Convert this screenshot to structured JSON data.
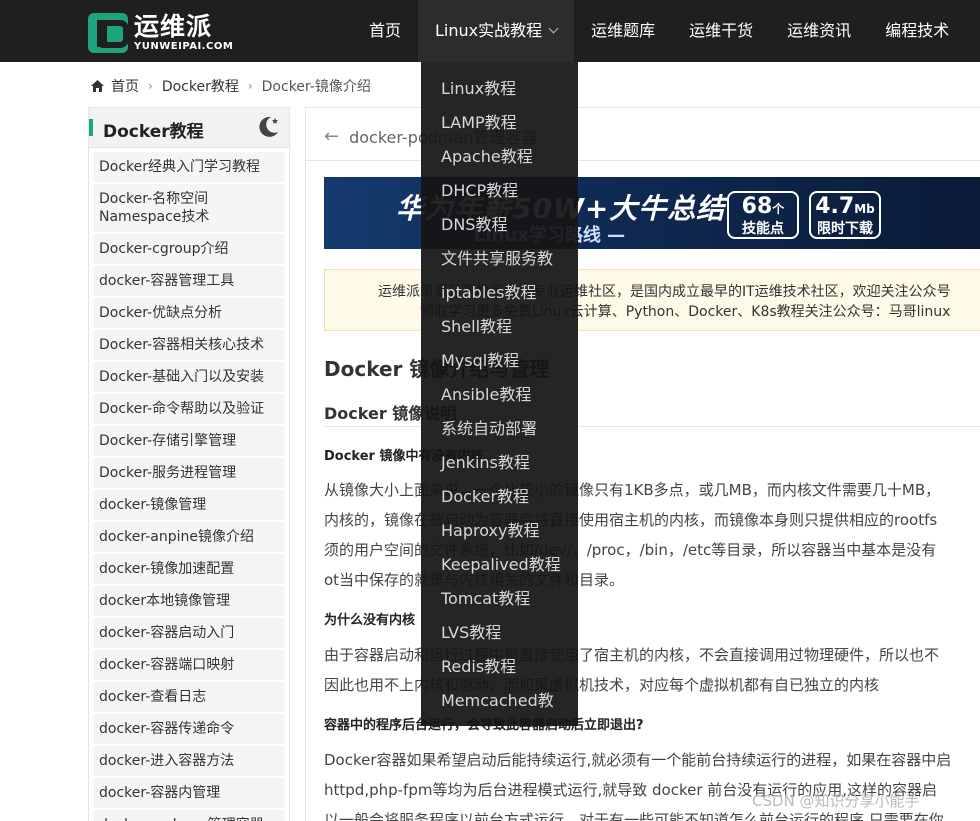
{
  "logo": {
    "cn": "运维派",
    "en": "YUNWEIPAI.COM"
  },
  "nav": [
    {
      "label": "首页"
    },
    {
      "label": "Linux实战教程"
    },
    {
      "label": "运维题库"
    },
    {
      "label": "运维干货"
    },
    {
      "label": "运维资讯"
    },
    {
      "label": "编程技术"
    }
  ],
  "breadcrumb": {
    "home": "首页",
    "section": "Docker教程",
    "current": "Docker-镜像介绍"
  },
  "sidebar": {
    "title": "Docker教程",
    "items": [
      "Docker经典入门学习教程",
      "Docker-名称空间Namespace技术",
      "Docker-cgroup介绍",
      "docker-容器管理工具",
      "Docker-优缺点分析",
      "Docker-容器相关核心技术",
      "Docker-基础入门以及安装",
      "Docker-命令帮助以及验证",
      "Docker-存储引擎管理",
      "Docker-服务进程管理",
      "docker-镜像管理",
      "docker-anpine镜像介绍",
      "docker-镜像加速配置",
      "docker本地镜像管理",
      "docker-容器启动入门",
      "docker-容器端口映射",
      "docker-查看日志",
      "docker-容器传递命令",
      "docker-进入容器方法",
      "docker-容器内管理",
      "docker-podman管理容器"
    ]
  },
  "main": {
    "back_text": "docker-podman管理容器",
    "banner": {
      "title": "华为年薪50W+大牛总结",
      "subtitle": "Linux学习路线 —",
      "badge1_num": "68",
      "badge1_unit": "个",
      "badge1_label": "技能点",
      "badge2_num": "4.7",
      "badge2_unit": "Mb",
      "badge2_label": "限时下载"
    },
    "notice_line1": "运维派隶属马哥教育旗下专业运维社区，是国内成立最早的IT运维技术社区，欢迎关注公众号",
    "notice_line2": "领取学习更多免费Linux云计算、Python、Docker、K8s教程关注公众号：马哥linux",
    "h1": "Docker 镜像介绍与管理",
    "h2": "Docker 镜像说明",
    "h3_1": "Docker 镜像中有没有内核",
    "p1": [
      "从镜像大小上面来说，一个比较小的镜像只有1KB多点，或几MB，而内核文件需要几十MB，",
      "内核的，镜像在被启动为容器后将直接使用宿主机的内核，而镜像本身则只提供相应的rootfs",
      "须的用户空间的文件系统，比如/dev/，/proc，/bin，/etc等目录，所以容器当中基本是没有",
      "ot当中保存的就是与内核相关的文件和目录。"
    ],
    "h3_2": "为什么没有内核",
    "p2": [
      "由于容器启动和运行过程中是直接使用了宿主机的内核，不会直接调用过物理硬件，所以也不",
      "因此也用不上内核和驱动，而如果虚拟机技术，对应每个虚拟机都有自已独立的内核"
    ],
    "h3_3": "容器中的程序后台运行，会导致此容器启动后立即退出?",
    "p3": [
      "Docker容器如果希望启动后能持续运行,就必须有一个能前台持续运行的进程，如果在容器中启",
      "httpd,php-fpm等均为后台进程模式运行,就导致 docker 前台没有运行的应用,这样的容器启",
      "以一般会将服务程序以前台方式运行，对于有一些可能不知道怎么前台运行的程序,只需要在你"
    ]
  },
  "dropdown": [
    "Linux教程",
    "LAMP教程",
    "Apache教程",
    "DHCP教程",
    "DNS教程",
    "文件共享服务教",
    "iptables教程",
    "Shell教程",
    "Mysql教程",
    "Ansible教程",
    "系统自动部署",
    "Jenkins教程",
    "Docker教程",
    "Haproxy教程",
    "Keepalived教程",
    "Tomcat教程",
    "LVS教程",
    "Redis教程",
    "Memcached教"
  ],
  "watermark": "CSDN @知识分享小能手",
  "colors": {
    "brand_green": "#1ea37c",
    "topbar_bg": "#1f1f1f"
  }
}
